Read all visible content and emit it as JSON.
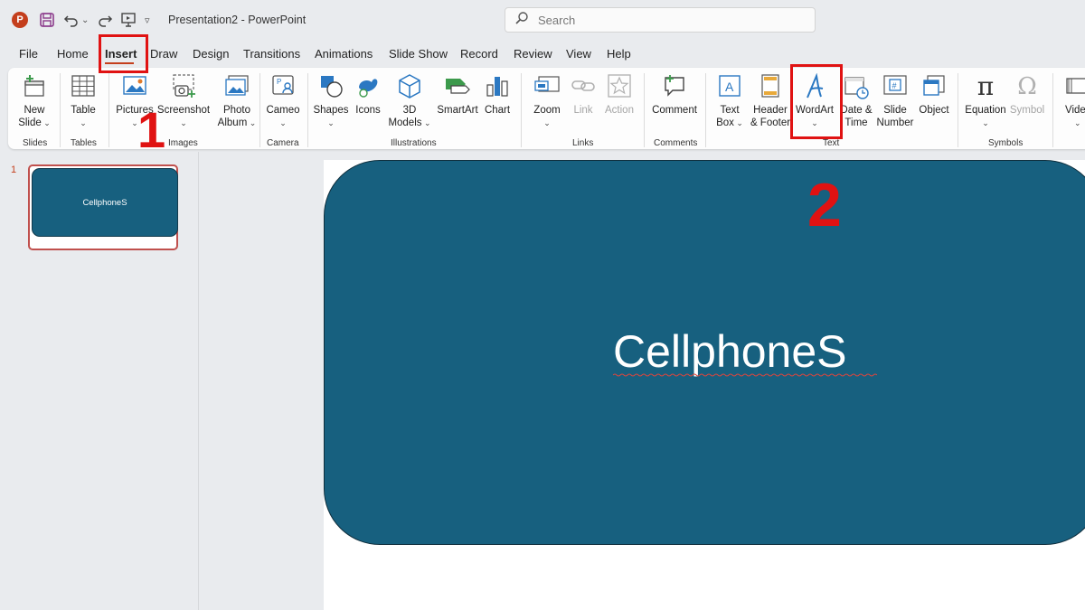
{
  "title_bar": {
    "app_logo": "P",
    "doc_title": "Presentation2  -  PowerPoint",
    "search_placeholder": "Search"
  },
  "tabs": [
    {
      "label": "File"
    },
    {
      "label": "Home"
    },
    {
      "label": "Insert",
      "active": true
    },
    {
      "label": "Draw"
    },
    {
      "label": "Design"
    },
    {
      "label": "Transitions"
    },
    {
      "label": "Animations"
    },
    {
      "label": "Slide Show"
    },
    {
      "label": "Record"
    },
    {
      "label": "Review"
    },
    {
      "label": "View"
    },
    {
      "label": "Help"
    }
  ],
  "ribbon": {
    "commands": {
      "new_slide": [
        "New",
        "Slide"
      ],
      "table": "Table",
      "pictures": "Pictures",
      "screenshot": "Screenshot",
      "photo_album": [
        "Photo",
        "Album"
      ],
      "cameo": "Cameo",
      "shapes": "Shapes",
      "icons": "Icons",
      "models_3d": [
        "3D",
        "Models"
      ],
      "smartart": "SmartArt",
      "chart": "Chart",
      "zoom": "Zoom",
      "link": "Link",
      "action": "Action",
      "comment": "Comment",
      "text_box": [
        "Text",
        "Box"
      ],
      "header_footer": [
        "Header",
        "& Footer"
      ],
      "wordart": "WordArt",
      "date_time": [
        "Date &",
        "Time"
      ],
      "slide_number": [
        "Slide",
        "Number"
      ],
      "object": "Object",
      "equation": "Equation",
      "symbol": "Symbol",
      "video": "Vide"
    },
    "groups": {
      "slides": "Slides",
      "tables": "Tables",
      "images": "Images",
      "camera": "Camera",
      "illustrations": "Illustrations",
      "links": "Links",
      "comments": "Comments",
      "text": "Text",
      "symbols": "Symbols"
    }
  },
  "thumbnails": [
    {
      "number": "1",
      "text": "CellphoneS"
    }
  ],
  "slide": {
    "text": "CellphoneS",
    "shape_color": "#17607f"
  },
  "annotations": {
    "step1": "1",
    "step2": "2",
    "highlight_color": "#e01212"
  },
  "colors": {
    "accent": "#c43e1c",
    "selection": "#c0504d"
  }
}
